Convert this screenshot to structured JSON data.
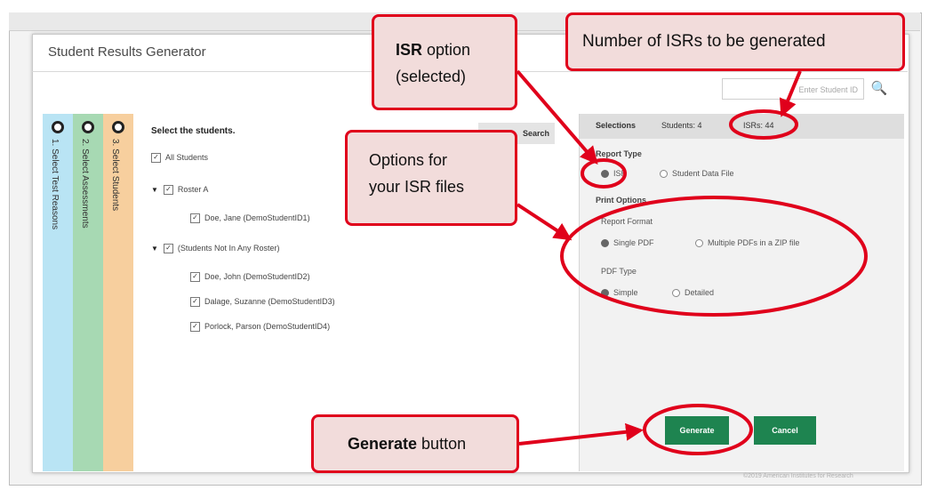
{
  "dialog": {
    "title": "Student Results Generator",
    "search_placeholder": "Enter Student ID",
    "footer": "©2019 American Institutes for Research"
  },
  "steps": [
    {
      "label": "1. Select Test Reasons"
    },
    {
      "label": "2. Select Assessments"
    },
    {
      "label": "3. Select Students"
    }
  ],
  "students": {
    "header": "Select the students.",
    "search_button": "Search",
    "all_label": "All Students",
    "groups": [
      {
        "name": "Roster A",
        "students": [
          "Doe, Jane (DemoStudentID1)"
        ]
      },
      {
        "name": "(Students Not In Any Roster)",
        "students": [
          "Doe, John (DemoStudentID2)",
          "Dalage, Suzanne (DemoStudentID3)",
          "Porlock, Parson (DemoStudentID4)"
        ]
      }
    ]
  },
  "selections": {
    "tab_selections": "Selections",
    "tab_students": "Students: 4",
    "tab_isrs": "ISRs: 44",
    "report_type_label": "Report Type",
    "isr_option": "ISR",
    "student_data_option": "Student Data File",
    "print_options_label": "Print Options",
    "report_format_label": "Report Format",
    "single_pdf": "Single PDF",
    "multiple_pdfs": "Multiple PDFs in a ZIP file",
    "pdf_type_label": "PDF Type",
    "simple": "Simple",
    "detailed": "Detailed",
    "generate_button": "Generate",
    "cancel_button": "Cancel"
  },
  "callouts": {
    "isr_bold": "ISR",
    "isr_rest": " option",
    "isr_line2": "(selected)",
    "number": "Number of ISRs to be generated",
    "options_line1": "Options for",
    "options_line2": "your ISR files",
    "generate_bold": "Generate",
    "generate_rest": " button"
  },
  "colors": {
    "accent_green": "#1e8450",
    "callout_red": "#e0001b",
    "callout_fill": "#f2dcdb"
  }
}
